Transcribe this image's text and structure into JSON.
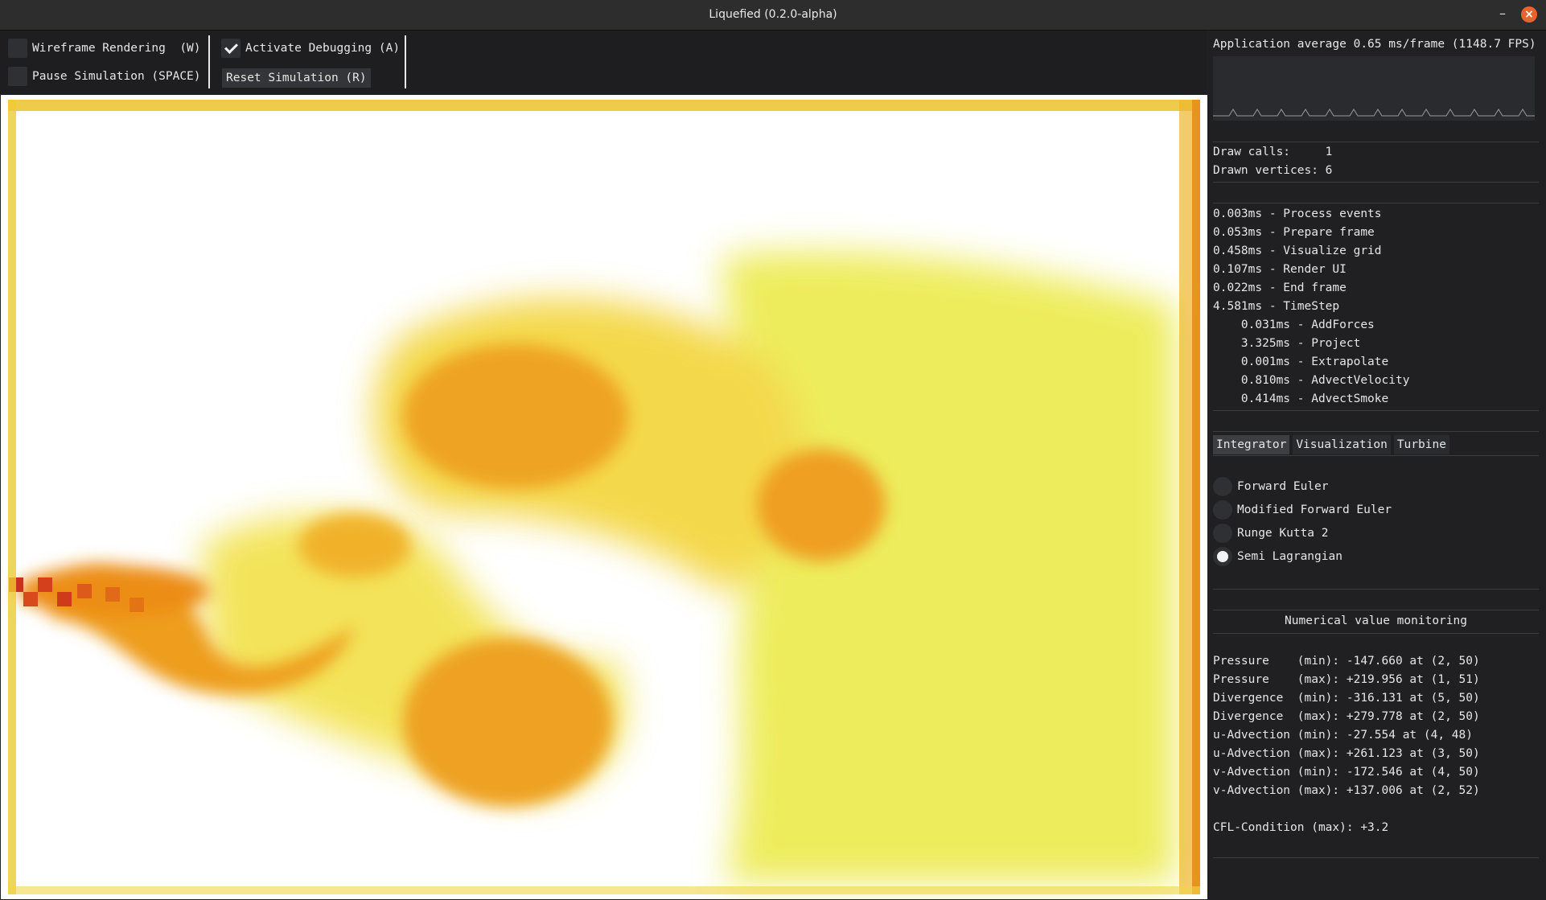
{
  "window": {
    "title": "Liquefied (0.2.0-alpha)",
    "minimize_glyph": "–",
    "close_glyph": "×"
  },
  "toolbar": {
    "wireframe": {
      "label": "Wireframe Rendering  (W)",
      "checked": false
    },
    "pause": {
      "label": "Pause Simulation (SPACE)",
      "checked": false
    },
    "debugging": {
      "label": "Activate Debugging (A)",
      "checked": true
    },
    "reset_label": "Reset Simulation (R)"
  },
  "stats": {
    "app_average": "Application average 0.65 ms/frame (1148.7 FPS)",
    "draw_calls": "Draw calls:     1",
    "drawn_vertices": "Drawn vertices: 6"
  },
  "timings": [
    "0.003ms - Process events",
    "0.053ms - Prepare frame",
    "0.458ms - Visualize grid",
    "0.107ms - Render UI",
    "0.022ms - End frame",
    "4.581ms - TimeStep",
    "    0.031ms - AddForces",
    "    3.325ms - Project",
    "    0.001ms - Extrapolate",
    "    0.810ms - AdvectVelocity",
    "    0.414ms - AdvectSmoke"
  ],
  "tabs": [
    "Integrator",
    "Visualization",
    "Turbine"
  ],
  "active_tab": "Integrator",
  "integrators": [
    "Forward Euler",
    "Modified Forward Euler",
    "Runge Kutta 2",
    "Semi Lagrangian"
  ],
  "selected_integrator": "Semi Lagrangian",
  "monitoring": {
    "title": "Numerical value monitoring",
    "rows": [
      "Pressure    (min): -147.660 at (2, 50)",
      "Pressure    (max): +219.956 at (1, 51)",
      "Divergence  (min): -316.131 at (5, 50)",
      "Divergence  (max): +279.778 at (2, 50)",
      "u-Advection (min): -27.554 at (4, 48)",
      "u-Advection (max): +261.123 at (3, 50)",
      "v-Advection (min): -172.546 at (4, 50)",
      "v-Advection (max): +137.006 at (2, 52)"
    ],
    "cfl": "CFL-Condition (max): +3.2"
  },
  "colors": {
    "smoke_dense": "#e98b12",
    "smoke_mid": "#f3c71c",
    "smoke_light": "#e8e43a",
    "wall": "#e8a21a"
  }
}
